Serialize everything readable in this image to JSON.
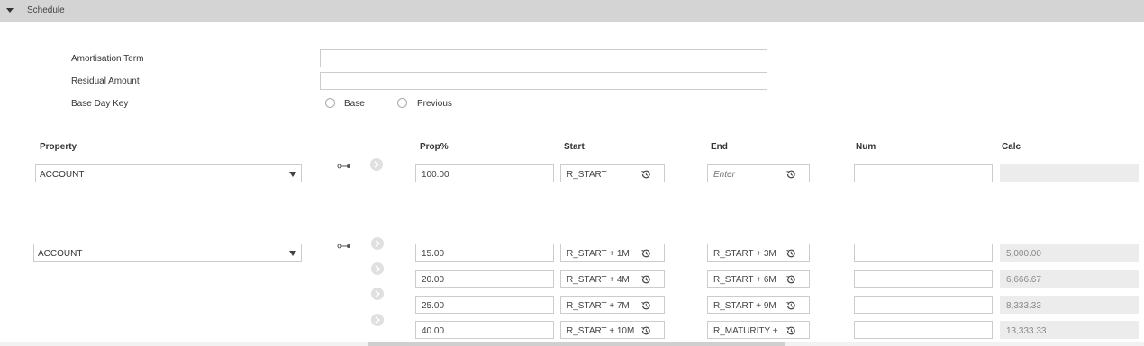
{
  "section": {
    "title": "Schedule"
  },
  "form": {
    "amortisation_term_label": "Amortisation Term",
    "residual_amount_label": "Residual Amount",
    "base_day_key_label": "Base Day Key",
    "radio_base": "Base",
    "radio_previous": "Previous"
  },
  "columns": {
    "property": "Property",
    "prop_pct": "Prop%",
    "start": "Start",
    "end": "End",
    "num": "Num",
    "calc": "Calc"
  },
  "row1": {
    "property": "ACCOUNT",
    "prop_pct": "100.00",
    "start": "R_START",
    "end_placeholder": "Enter",
    "num": "",
    "calc": ""
  },
  "row2": {
    "property": "ACCOUNT",
    "lines": [
      {
        "prop_pct": "15.00",
        "start": "R_START + 1M",
        "end": "R_START + 3M",
        "num": "",
        "calc": "5,000.00"
      },
      {
        "prop_pct": "20.00",
        "start": "R_START + 4M",
        "end": "R_START + 6M",
        "num": "",
        "calc": "6,666.67"
      },
      {
        "prop_pct": "25.00",
        "start": "R_START + 7M",
        "end": "R_START + 9M",
        "num": "",
        "calc": "8,333.33"
      },
      {
        "prop_pct": "40.00",
        "start": "R_START + 10M",
        "end": "R_MATURITY +",
        "num": "",
        "calc": "13,333.33"
      }
    ]
  },
  "icons": {
    "collapse": "triangle-down-icon",
    "link": "link-icon",
    "arrow": "chevron-right-icon",
    "history": "history-icon"
  }
}
